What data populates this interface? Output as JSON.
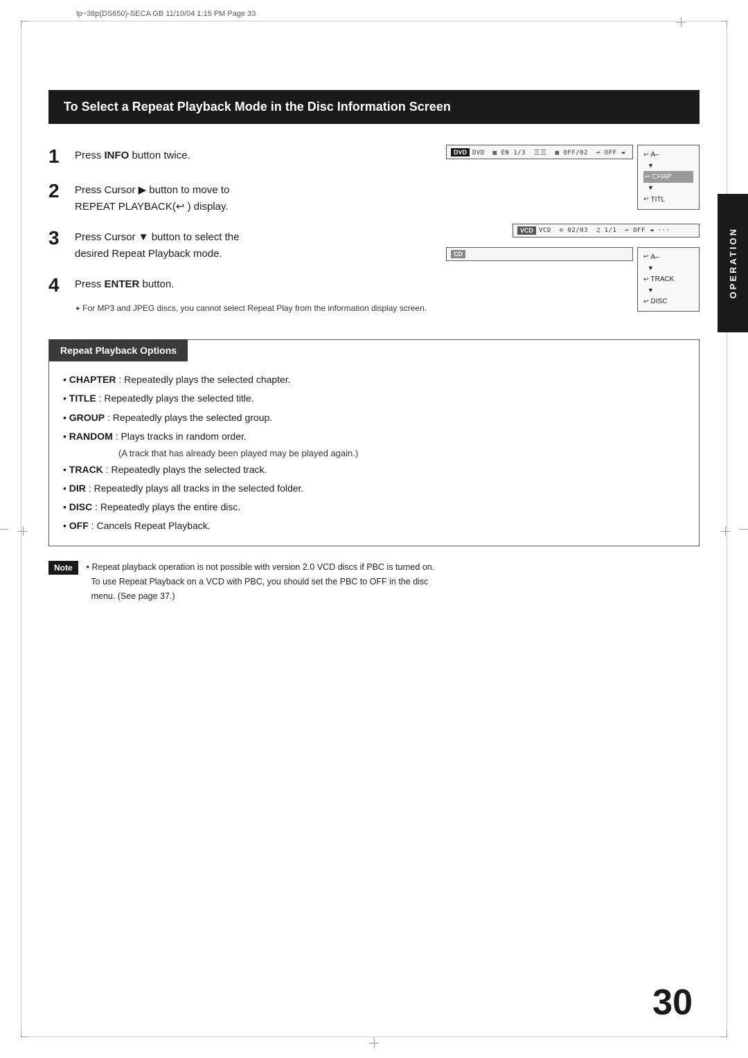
{
  "header": {
    "meta": "lp~38p(DS650)-SECA GB  11/10/04  1:15 PM  Page  33"
  },
  "operation_tab": "OPERATION",
  "title": "To Select a Repeat Playback Mode in the Disc Information Screen",
  "steps": [
    {
      "num": "1",
      "text": "Press ",
      "bold": "INFO",
      "text2": " button twice."
    },
    {
      "num": "2",
      "text": "Press Cursor ▶ button to move to REPEAT PLAYBACK(↩ ) display."
    },
    {
      "num": "3",
      "text": "Press Cursor ▼ button to select the desired Repeat Playback mode."
    },
    {
      "num": "4",
      "text": "Press ",
      "bold": "ENTER",
      "text2": " button."
    }
  ],
  "footnote": "For MP3 and JPEG discs, you cannot select Repeat Play from the information display screen.",
  "dvd_panel": "DVD  DVD  🔲 EN 1/3  五五  🔲 OFF/ 02  ↩ OFF ◄",
  "dvd_menu": {
    "items": [
      "↩ A–",
      "▼",
      "↩ CHAP",
      "▼",
      "↩ TITL"
    ]
  },
  "vcd_panel": "VCD  VCD  ⊙ 02/03  🎵 1/1  ↩ OFF ◄ ○○○",
  "cd_panel": "CD",
  "cd_menu": {
    "items": [
      "↩ A–",
      "▼",
      "↩ TRACK",
      "▼",
      "↩ DISC"
    ]
  },
  "options_header": "Repeat Playback Options",
  "options": [
    {
      "bold": "CHAPTER",
      "text": " : Repeatedly plays the selected chapter."
    },
    {
      "bold": "TITLE",
      "text": " : Repeatedly plays the selected title."
    },
    {
      "bold": "GROUP",
      "text": " : Repeatedly plays the selected group."
    },
    {
      "bold": "RANDOM",
      "text": " : Plays tracks in random order.",
      "sub": "(A track that has already been played may be played again.)"
    },
    {
      "bold": "TRACK",
      "text": " : Repeatedly plays the selected track."
    },
    {
      "bold": "DIR",
      "text": " : Repeatedly plays all tracks in the selected folder."
    },
    {
      "bold": "DISC",
      "text": " : Repeatedly plays the entire disc."
    },
    {
      "bold": "OFF",
      "text": " : Cancels Repeat Playback."
    }
  ],
  "note_label": "Note",
  "note_text": "• Repeat playback operation is not possible with version 2.0 VCD discs if PBC is turned on.\n  To use Repeat Playback on a VCD with PBC, you should set the PBC to OFF in the disc\n  menu. (See page 37.)",
  "page_number": "30"
}
